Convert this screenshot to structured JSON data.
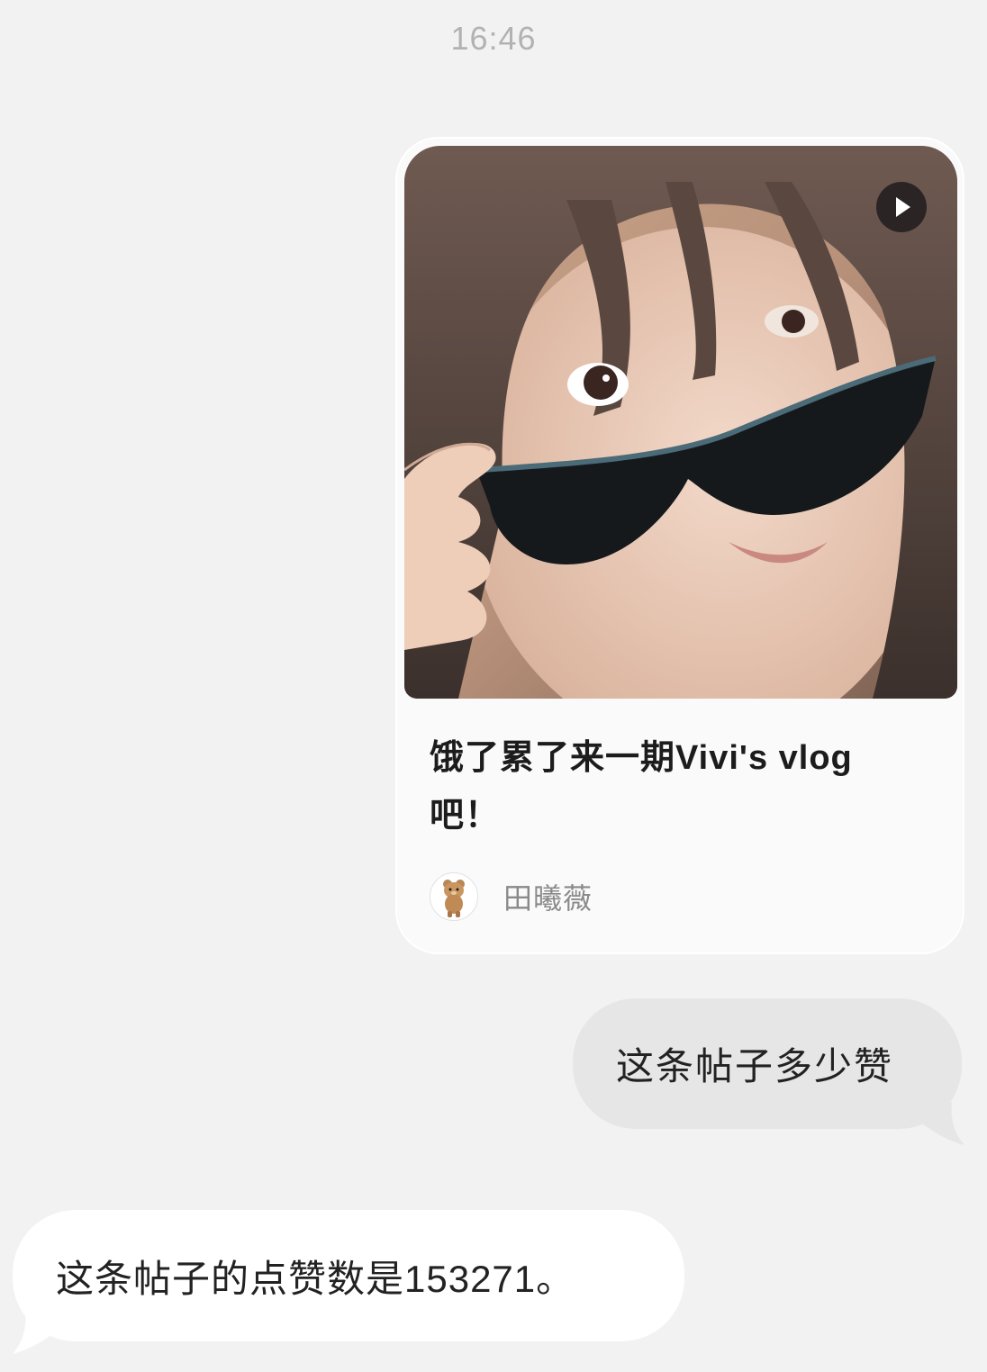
{
  "chat": {
    "timestamp": "16:46"
  },
  "shared_post": {
    "title": "饿了累了来一期Vivi's vlog吧！",
    "author_name": "田曦薇",
    "cover_alt": "selfie holding sunglasses",
    "play_icon": "play-icon",
    "avatar_icon": "teddy-bear-avatar"
  },
  "messages": [
    {
      "from": "user",
      "text": "这条帖子多少赞"
    },
    {
      "from": "assistant",
      "text": "这条帖子的点赞数是153271。"
    }
  ],
  "colors": {
    "background": "#f2f2f2",
    "outgoing_bubble": "#e6e6e6",
    "incoming_bubble": "#ffffff",
    "card": "#fafafa",
    "timestamp": "#b2b2b2",
    "author": "#8a8a8a"
  }
}
